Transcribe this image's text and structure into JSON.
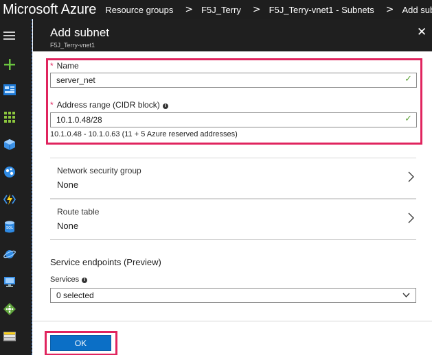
{
  "topbar": {
    "brand": "Microsoft Azure",
    "breadcrumbs": [
      "Resource groups",
      "F5J_Terry",
      "F5J_Terry-vnet1 - Subnets",
      "Add subnet"
    ],
    "separator": ">"
  },
  "leftnav": {
    "icons": [
      "menu-icon",
      "create-resource-icon",
      "dashboard-icon",
      "all-services-icon",
      "resource-groups-icon",
      "app-services-icon",
      "function-apps-icon",
      "sql-databases-icon",
      "cosmos-db-icon",
      "virtual-machines-icon",
      "load-balancers-icon",
      "storage-accounts-icon"
    ]
  },
  "blade": {
    "title": "Add subnet",
    "subtitle": "F5J_Terry-vnet1",
    "close_glyph": "✕",
    "name_label": "Name",
    "name_value": "server_net",
    "required_mark": "*",
    "range_label": "Address range (CIDR block)",
    "info_glyph": "i",
    "range_value": "10.1.0.48/28",
    "range_hint": "10.1.0.48 - 10.1.0.63 (11 + 5 Azure reserved addresses)",
    "valid_glyph": "✓",
    "nsg_title": "Network security group",
    "nsg_value": "None",
    "route_title": "Route table",
    "route_value": "None",
    "service_endpoints_title": "Service endpoints (Preview)",
    "services_label": "Services",
    "services_value": "0 selected",
    "ok_label": "OK"
  },
  "colors": {
    "highlight": "#e0245e",
    "primary_button": "#0b6fc6",
    "valid_check": "#5ea33a",
    "topbar": "#1e1e1e"
  }
}
